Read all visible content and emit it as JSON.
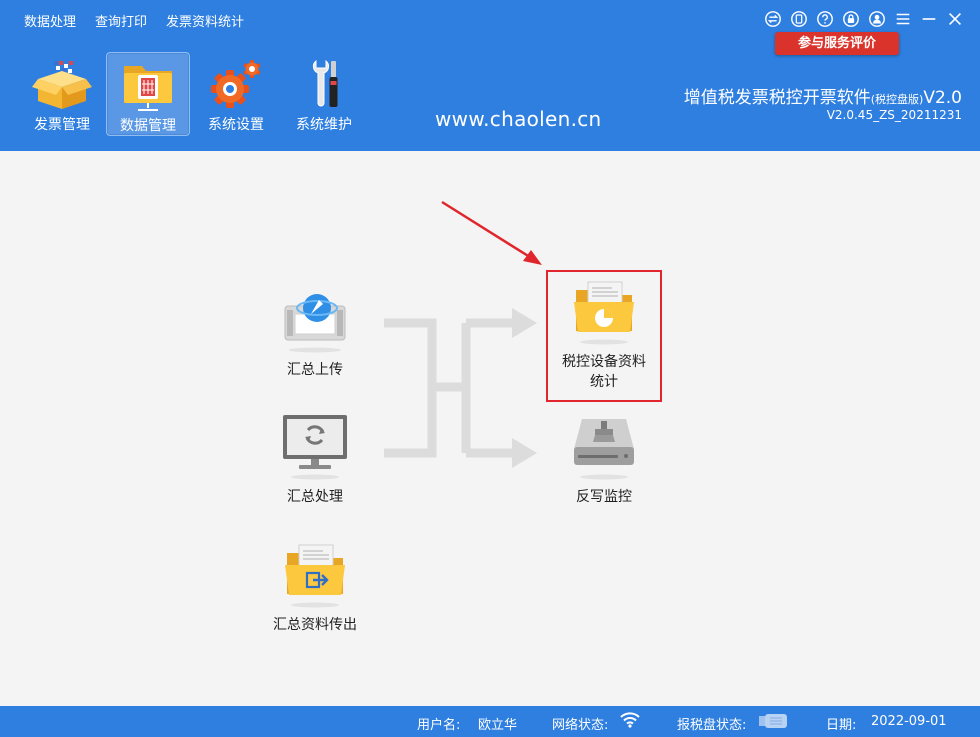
{
  "menu": {
    "data_process": "数据处理",
    "query_print": "查询打印",
    "invoice_stats": "发票资料统计"
  },
  "icons": {
    "exchange": "exchange-icon",
    "phone": "phone-icon",
    "help": "help-icon",
    "lock": "lock-icon",
    "user": "user-icon",
    "menu": "menu-icon",
    "minimize": "minimize-icon",
    "close": "close-icon"
  },
  "eval_button": "参与服务评价",
  "nav": {
    "invoice_mgmt": "发票管理",
    "data_mgmt": "数据管理",
    "system_settings": "系统设置",
    "system_maintenance": "系统维护"
  },
  "website": "www.chaolen.cn",
  "app": {
    "title_main": "增值税发票税控开票软件",
    "title_edition": "(税控盘版)",
    "title_version": "V2.0",
    "build": "V2.0.45_ZS_20211231"
  },
  "tiles": {
    "upload": "汇总上传",
    "process": "汇总处理",
    "export": "汇总资料传出",
    "device_stats_line1": "税控设备资料",
    "device_stats_line2": "统计",
    "writeback": "反写监控"
  },
  "status": {
    "user_label": "用户名:",
    "user_value": "欧立华",
    "network_label": "网络状态:",
    "disk_label": "报税盘状态:",
    "date_label": "日期:",
    "date_value": "2022-09-01"
  },
  "colors": {
    "header_blue": "#2f7fe0",
    "eval_red": "#d9332b",
    "highlight_red": "#e0262c"
  }
}
